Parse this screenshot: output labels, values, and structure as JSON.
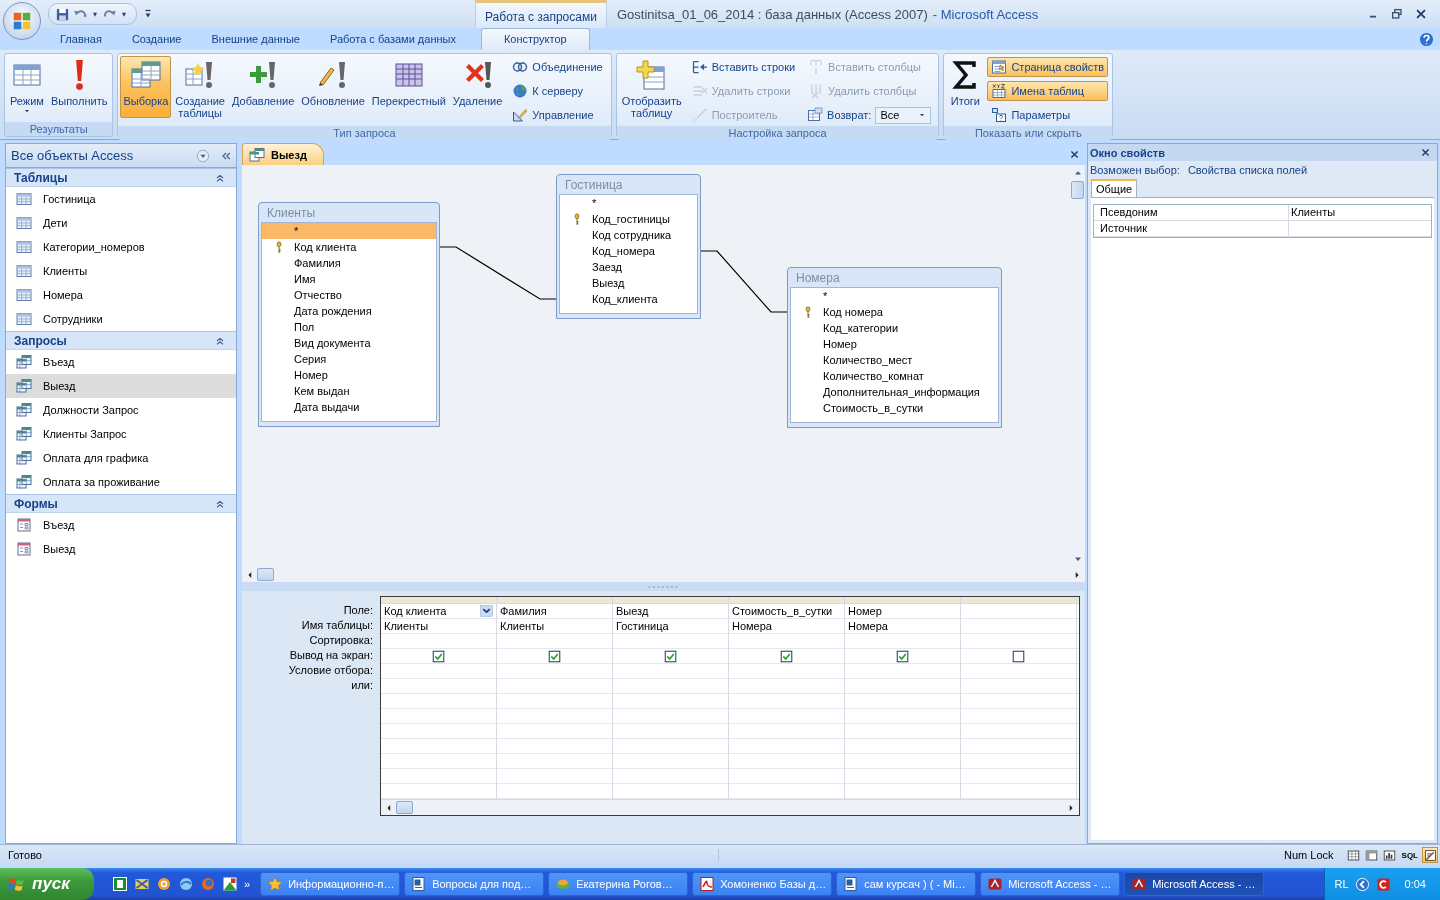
{
  "title_bar": {
    "contextual_tab": "Работа с запросами",
    "document": "Gostinitsa_01_06_2014 : база данных (Access 2007)",
    "app": "- Microsoft Access"
  },
  "ribbon_tabs": [
    {
      "label": "Главная",
      "selected": false
    },
    {
      "label": "Создание",
      "selected": false
    },
    {
      "label": "Внешние данные",
      "selected": false
    },
    {
      "label": "Работа с базами данных",
      "selected": false
    },
    {
      "label": "Конструктор",
      "selected": true
    }
  ],
  "ribbon_groups": [
    {
      "title": "Результаты",
      "buttons": [
        {
          "kind": "large",
          "label": "Режим",
          "menu": true,
          "selected": false,
          "disabled": false
        },
        {
          "kind": "large",
          "label": "Выполнить",
          "menu": false,
          "selected": false,
          "disabled": false
        }
      ]
    },
    {
      "title": "Тип запроса",
      "buttons": [
        {
          "kind": "large",
          "label": "Выборка",
          "menu": false,
          "selected": true,
          "disabled": false
        },
        {
          "kind": "large",
          "label": "Создание таблицы",
          "menu": false,
          "selected": false,
          "disabled": false
        },
        {
          "kind": "large",
          "label": "Добавление",
          "menu": false,
          "selected": false,
          "disabled": false
        },
        {
          "kind": "large",
          "label": "Обновление",
          "menu": false,
          "selected": false,
          "disabled": false
        },
        {
          "kind": "large",
          "label": "Перекрестный",
          "menu": false,
          "selected": false,
          "disabled": false
        },
        {
          "kind": "large",
          "label": "Удаление",
          "menu": false,
          "selected": false,
          "disabled": false
        },
        {
          "kind": "small",
          "label": "Объединение",
          "selected": false,
          "disabled": false
        },
        {
          "kind": "small",
          "label": "К серверу",
          "selected": false,
          "disabled": false
        },
        {
          "kind": "small",
          "label": "Управление",
          "selected": false,
          "disabled": false
        }
      ]
    },
    {
      "title": "Настройка запроса",
      "buttons": [
        {
          "kind": "large",
          "label": "Отобразить таблицу",
          "menu": false,
          "selected": false,
          "disabled": false
        },
        {
          "kind": "small",
          "label": "Вставить строки",
          "selected": false,
          "disabled": false
        },
        {
          "kind": "small",
          "label": "Удалить строки",
          "selected": false,
          "disabled": true
        },
        {
          "kind": "small",
          "label": "Построитель",
          "selected": false,
          "disabled": true
        },
        {
          "kind": "small",
          "label": "Вставить столбцы",
          "selected": false,
          "disabled": true
        },
        {
          "kind": "small",
          "label": "Удалить столбцы",
          "selected": false,
          "disabled": true
        },
        {
          "kind": "dropdown",
          "label": "Возврат:",
          "value": "Все"
        }
      ]
    },
    {
      "title": "Показать или скрыть",
      "buttons": [
        {
          "kind": "large",
          "label": "Итоги",
          "menu": false,
          "selected": false,
          "disabled": false
        },
        {
          "kind": "small",
          "label": "Страница свойств",
          "selected": true,
          "disabled": false
        },
        {
          "kind": "small",
          "label": "Имена таблиц",
          "selected": true,
          "disabled": false
        },
        {
          "kind": "small",
          "label": "Параметры",
          "selected": false,
          "disabled": false
        }
      ]
    }
  ],
  "navigation_pane": {
    "title": "Все объекты Access",
    "sections": [
      {
        "kind": "table",
        "title": "Таблицы",
        "expanded": true,
        "items": [
          {
            "label": "Гостиница",
            "selected": false
          },
          {
            "label": "Дети",
            "selected": false
          },
          {
            "label": "Категории_номеров",
            "selected": false
          },
          {
            "label": "Клиенты",
            "selected": false
          },
          {
            "label": "Номера",
            "selected": false
          },
          {
            "label": "Сотрудники",
            "selected": false
          }
        ]
      },
      {
        "kind": "query",
        "title": "Запросы",
        "expanded": true,
        "items": [
          {
            "label": "Въезд",
            "selected": false
          },
          {
            "label": "Выезд",
            "selected": true
          },
          {
            "label": "Должности Запрос",
            "selected": false
          },
          {
            "label": "Клиенты Запрос",
            "selected": false
          },
          {
            "label": "Оплата для графика",
            "selected": false
          },
          {
            "label": "Оплата за проживание",
            "selected": false
          }
        ]
      },
      {
        "kind": "form",
        "title": "Формы",
        "expanded": true,
        "items": [
          {
            "label": "Въезд",
            "selected": false
          },
          {
            "label": "Выезд",
            "selected": false
          }
        ]
      }
    ]
  },
  "document_tabs": [
    {
      "label": "Выезд",
      "selected": true
    }
  ],
  "field_lists": [
    {
      "title": "Клиенты",
      "fields": [
        {
          "name": "*",
          "key": false,
          "selected": true
        },
        {
          "name": "Код клиента",
          "key": true,
          "selected": false
        },
        {
          "name": "Фамилия",
          "key": false,
          "selected": false
        },
        {
          "name": "Имя",
          "key": false,
          "selected": false
        },
        {
          "name": "Отчество",
          "key": false,
          "selected": false
        },
        {
          "name": "Дата рождения",
          "key": false,
          "selected": false
        },
        {
          "name": "Пол",
          "key": false,
          "selected": false
        },
        {
          "name": "Вид документа",
          "key": false,
          "selected": false
        },
        {
          "name": "Серия",
          "key": false,
          "selected": false
        },
        {
          "name": "Номер",
          "key": false,
          "selected": false
        },
        {
          "name": "Кем выдан",
          "key": false,
          "selected": false
        },
        {
          "name": "Дата выдачи",
          "key": false,
          "selected": false
        }
      ]
    },
    {
      "title": "Гостиница",
      "fields": [
        {
          "name": "*",
          "key": false,
          "selected": false
        },
        {
          "name": "Код_гостиницы",
          "key": true,
          "selected": false
        },
        {
          "name": "Код сотрудника",
          "key": false,
          "selected": false
        },
        {
          "name": "Код_номера",
          "key": false,
          "selected": false
        },
        {
          "name": "Заезд",
          "key": false,
          "selected": false
        },
        {
          "name": "Выезд",
          "key": false,
          "selected": false
        },
        {
          "name": "Код_клиента",
          "key": false,
          "selected": false
        }
      ]
    },
    {
      "title": "Номера",
      "fields": [
        {
          "name": "*",
          "key": false,
          "selected": false
        },
        {
          "name": "Код номера",
          "key": true,
          "selected": false
        },
        {
          "name": "Код_категории",
          "key": false,
          "selected": false
        },
        {
          "name": "Номер",
          "key": false,
          "selected": false
        },
        {
          "name": "Количество_мест",
          "key": false,
          "selected": false
        },
        {
          "name": "Количество_комнат",
          "key": false,
          "selected": false
        },
        {
          "name": "Дополнительная_информация",
          "key": false,
          "selected": false
        },
        {
          "name": "Стоимость_в_сутки",
          "key": false,
          "selected": false
        }
      ]
    }
  ],
  "design_grid": {
    "row_labels": [
      "Поле:",
      "Имя таблицы:",
      "Сортировка:",
      "Вывод на экран:",
      "Условие отбора:",
      "или:"
    ],
    "columns": [
      {
        "field": "Код клиента",
        "table": "Клиенты",
        "show": true,
        "selected": true
      },
      {
        "field": "Фамилия",
        "table": "Клиенты",
        "show": true,
        "selected": false
      },
      {
        "field": "Выезд",
        "table": "Гостиница",
        "show": true,
        "selected": false
      },
      {
        "field": "Стоимость_в_сутки",
        "table": "Номера",
        "show": true,
        "selected": false
      },
      {
        "field": "Номер",
        "table": "Номера",
        "show": true,
        "selected": false
      },
      {
        "show": false,
        "selected": false
      }
    ]
  },
  "property_sheet": {
    "title": "Окно свойств",
    "selection_label": "Возможен выбор:",
    "selection": "Свойства списка полей",
    "tabs": [
      {
        "label": "Общие",
        "selected": true
      }
    ],
    "properties": [
      {
        "name": "Псевдоним",
        "value": "Клиенты"
      },
      {
        "name": "Источник"
      }
    ]
  },
  "status_bar": {
    "text": "Готово",
    "indicator": "Num Lock",
    "views": [
      {
        "kind": "datasheet",
        "selected": false
      },
      {
        "kind": "pivottable",
        "selected": false
      },
      {
        "kind": "pivotchart",
        "selected": false
      },
      {
        "kind": "sql",
        "label": "SQL",
        "selected": false
      },
      {
        "kind": "design",
        "selected": true
      }
    ]
  },
  "taskbar": {
    "start": "пуск",
    "more": "»",
    "tasks": [
      {
        "kind": "star",
        "label": "Информационно-п…",
        "selected": false
      },
      {
        "kind": "document",
        "label": "Вопросы для под…",
        "selected": false
      },
      {
        "kind": "messenger",
        "label": "Екатерина Рогов…",
        "selected": false
      },
      {
        "kind": "pdf",
        "label": "Хомоненко Базы д…",
        "selected": false
      },
      {
        "kind": "document",
        "label": "сам курсач ) ( - Mi…",
        "selected": false
      },
      {
        "kind": "access",
        "label": "Microsoft Access - …",
        "selected": false
      },
      {
        "kind": "access",
        "label": "Microsoft Access - …",
        "selected": true
      }
    ],
    "language": "RL",
    "clock": "0:04"
  }
}
